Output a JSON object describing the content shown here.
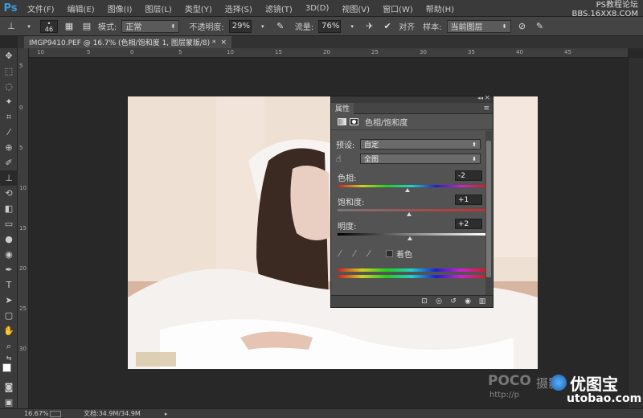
{
  "app": {
    "logo": "Ps"
  },
  "menu": [
    "文件(F)",
    "编辑(E)",
    "图像(I)",
    "图层(L)",
    "类型(Y)",
    "选择(S)",
    "滤镜(T)",
    "3D(D)",
    "视图(V)",
    "窗口(W)",
    "帮助(H)"
  ],
  "watermark_top": {
    "line1": "PS教程论坛",
    "line2": "BBS.16XX8.COM"
  },
  "options": {
    "brush_size": "46",
    "mode_label": "模式:",
    "mode_value": "正常",
    "opacity_label": "不透明度:",
    "opacity_value": "29%",
    "flow_label": "流量:",
    "flow_value": "76%",
    "align_label": "对齐",
    "sample_label": "样本:",
    "sample_value": "当前图层"
  },
  "document": {
    "tab_title": "IMGP9410.PEF @ 16.7% (色相/饱和度 1, 图层蒙版/8) *",
    "close": "×"
  },
  "ruler_h": [
    "10",
    "5",
    "0",
    "5",
    "10",
    "15",
    "20",
    "25",
    "30",
    "35",
    "40",
    "45"
  ],
  "ruler_v": [
    "5",
    "0",
    "5",
    "10",
    "15",
    "20",
    "25",
    "30"
  ],
  "panel": {
    "tab": "属性",
    "collapse": "◂◂",
    "close": "×",
    "menu": "≡",
    "title": "色相/饱和度",
    "preset_label": "预设:",
    "preset_value": "自定",
    "channel_value": "全图",
    "hue_label": "色相:",
    "hue_value": "-2",
    "saturation_label": "饱和度:",
    "saturation_value": "+1",
    "lightness_label": "明度:",
    "lightness_value": "+2",
    "colorize_label": "着色"
  },
  "status": {
    "zoom": "16.67%",
    "doc_info": "文档:34.9M/34.9M"
  },
  "watermark_bottom": {
    "poco": "POCO",
    "poco_cn": "摄影",
    "youtubao": "优图宝",
    "url": "utobao.com",
    "http": "http://p"
  },
  "colors": {
    "accent": "#3a9bd9",
    "panel_bg": "#535353",
    "app_bg": "#282828"
  },
  "icons": [
    "move-icon",
    "marquee-icon",
    "lasso-icon",
    "quick-select-icon",
    "crop-icon",
    "eyedropper-icon",
    "healing-icon",
    "brush-icon",
    "clone-stamp-icon",
    "history-brush-icon",
    "eraser-icon",
    "gradient-icon",
    "blur-icon",
    "dodge-icon",
    "pen-icon",
    "type-icon",
    "path-select-icon",
    "shape-icon",
    "hand-icon",
    "zoom-icon"
  ]
}
